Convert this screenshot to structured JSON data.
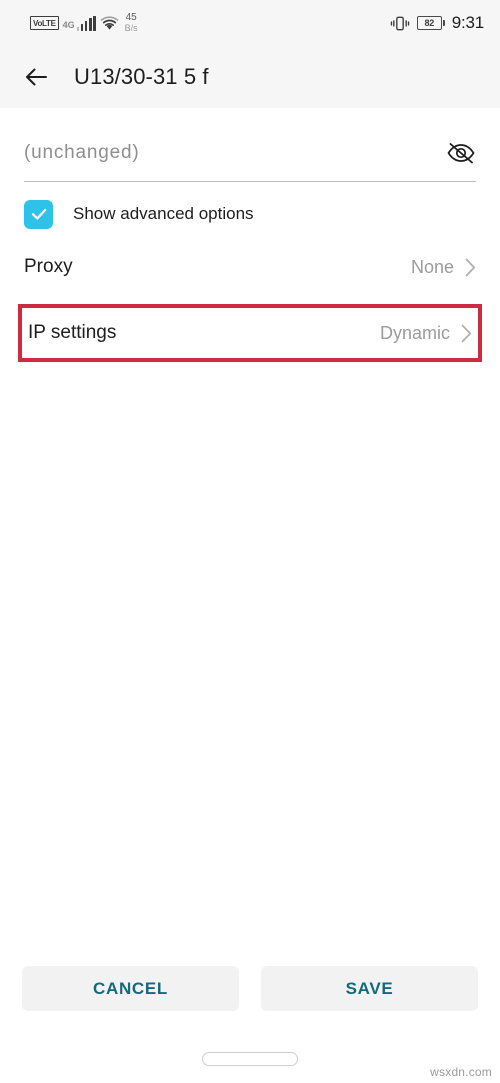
{
  "status_bar": {
    "volte_label": "VoLTE",
    "network_type": "4G",
    "signal_icon": "signal-bars-icon",
    "wifi_icon": "wifi-icon",
    "data_rate_value": "45",
    "data_rate_unit": "B/s",
    "vibrate_icon": "vibrate-icon",
    "battery_level": "82",
    "time": "9:31"
  },
  "app_bar": {
    "back_icon": "back-arrow-icon",
    "title": "U13/30-31 5 f"
  },
  "password_field": {
    "value": "(unchanged)",
    "placeholder": "(unchanged)",
    "visibility_icon": "eye-off-icon"
  },
  "advanced_checkbox": {
    "label": "Show advanced options",
    "checked": true,
    "color": "#2ec2e8",
    "check_icon": "check-icon"
  },
  "settings_rows": [
    {
      "label": "Proxy",
      "value": "None",
      "chevron_icon": "chevron-right-icon",
      "highlighted": false
    },
    {
      "label": "IP settings",
      "value": "Dynamic",
      "chevron_icon": "chevron-right-icon",
      "highlighted": true
    }
  ],
  "highlight": {
    "color": "#cc2b41"
  },
  "footer": {
    "cancel_label": "CANCEL",
    "save_label": "SAVE",
    "accent_color": "#15697c"
  },
  "nav_bar": {
    "home_pill": "home-gesture-pill"
  },
  "watermark": {
    "text": "wsxdn.com"
  }
}
